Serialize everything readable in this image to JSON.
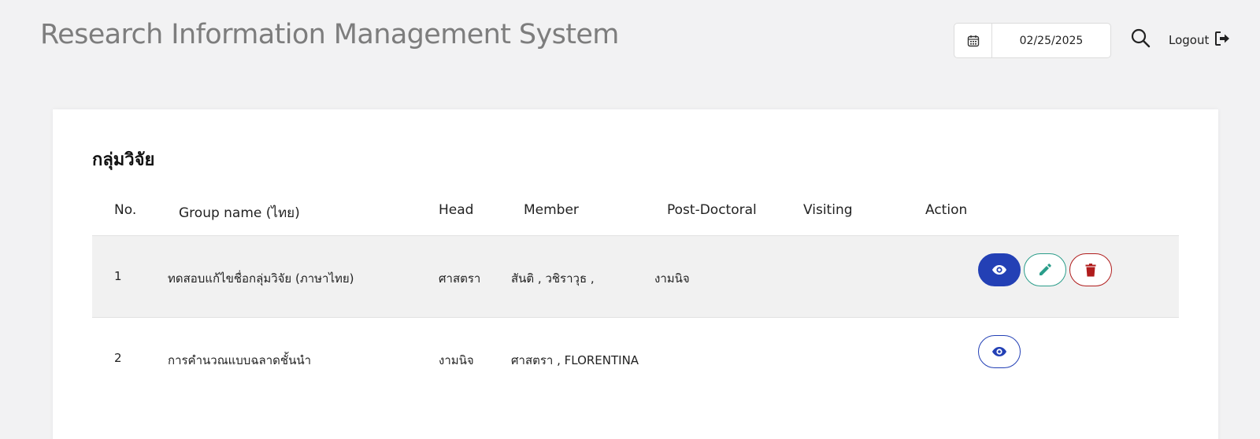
{
  "header": {
    "title": "Research Information Management System",
    "date": {
      "value": "02/25/2025"
    },
    "logout_label": "Logout",
    "icons": {
      "calendar": "calendar-icon",
      "search": "search-icon",
      "logout": "logout-icon"
    }
  },
  "groups": {
    "title": "กลุ่มวิจัย",
    "columns": {
      "no": "No.",
      "name": "Group name (ไทย)",
      "head": "Head",
      "member": "Member",
      "postdoc": "Post-Doctoral",
      "visiting": "Visiting",
      "action": "Action"
    },
    "rows": [
      {
        "no": "1",
        "name": "ทดสอบแก้ไขชื่อกลุ่มวิจัย (ภาษาไทย)",
        "head": "ศาสตรา",
        "member": "สันติ , วชิราวุธ ,",
        "postdoc": "งามนิจ",
        "visiting": "",
        "actions": [
          "view",
          "edit",
          "delete"
        ]
      },
      {
        "no": "2",
        "name": "การคำนวณแบบฉลาดชั้นนำ",
        "head": "งามนิจ",
        "member": "ศาสตรา , FLORENTINA",
        "postdoc": "",
        "visiting": "",
        "actions": [
          "view"
        ]
      }
    ]
  },
  "colors": {
    "view": "#2340b5",
    "edit": "#2a9d8a",
    "delete": "#b01c1c",
    "title_gray": "#7d7d7d",
    "background": "#f2f2f3"
  }
}
